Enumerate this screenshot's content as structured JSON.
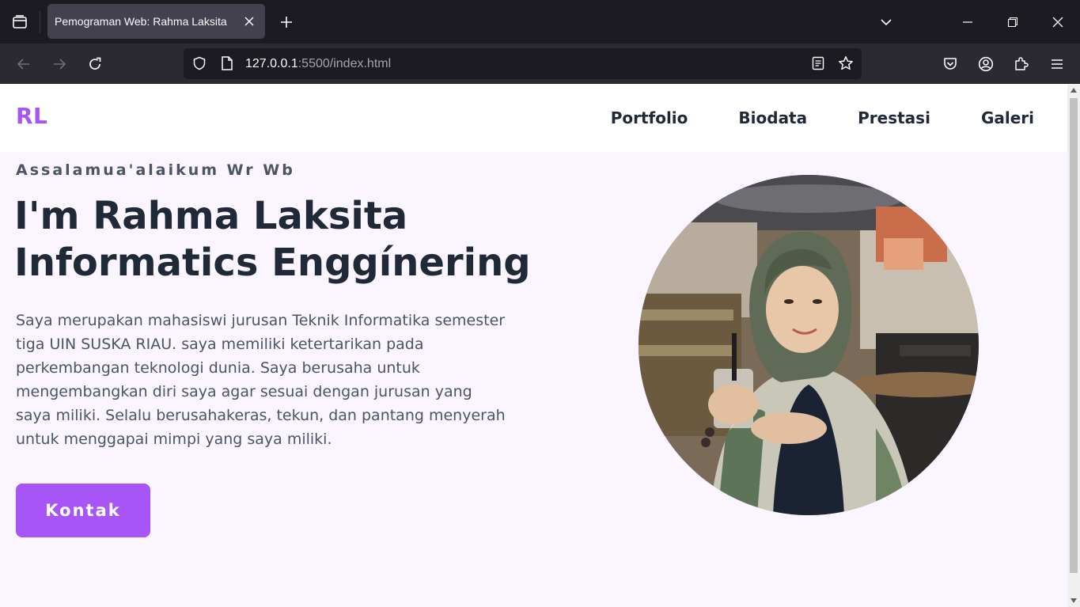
{
  "browser": {
    "tab_title": "Pemograman Web: Rahma Laksita",
    "url_host": "127.0.0.1",
    "url_path": ":5500/index.html"
  },
  "site": {
    "logo": "RL",
    "nav": [
      "Portfolio",
      "Biodata",
      "Prestasi",
      "Galeri"
    ],
    "greeting": "Assalamua'alaikum Wr Wb",
    "headline_prefix": "I'm ",
    "headline_name": "Rahma Laksita",
    "headline_role": "Informatics Enggínering",
    "bio": "Saya merupakan mahasiswi jurusan Teknik Informatika semester tiga UIN SUSKA RIAU. saya memiliki ketertarikan pada perkembangan teknologi dunia. Saya berusaha untuk mengembangkan diri saya agar sesuai dengan jurusan yang saya miliki. Selalu berusahakeras, tekun, dan pantang menyerah untuk menggapai mimpi yang saya miliki.",
    "cta_label": "Kontak"
  },
  "colors": {
    "accent": "#a855f7",
    "page_bg": "#faf5ff",
    "text_dark": "#1f2937",
    "text_muted": "#4b5563"
  },
  "icons": {
    "photo": "profile-photo"
  }
}
